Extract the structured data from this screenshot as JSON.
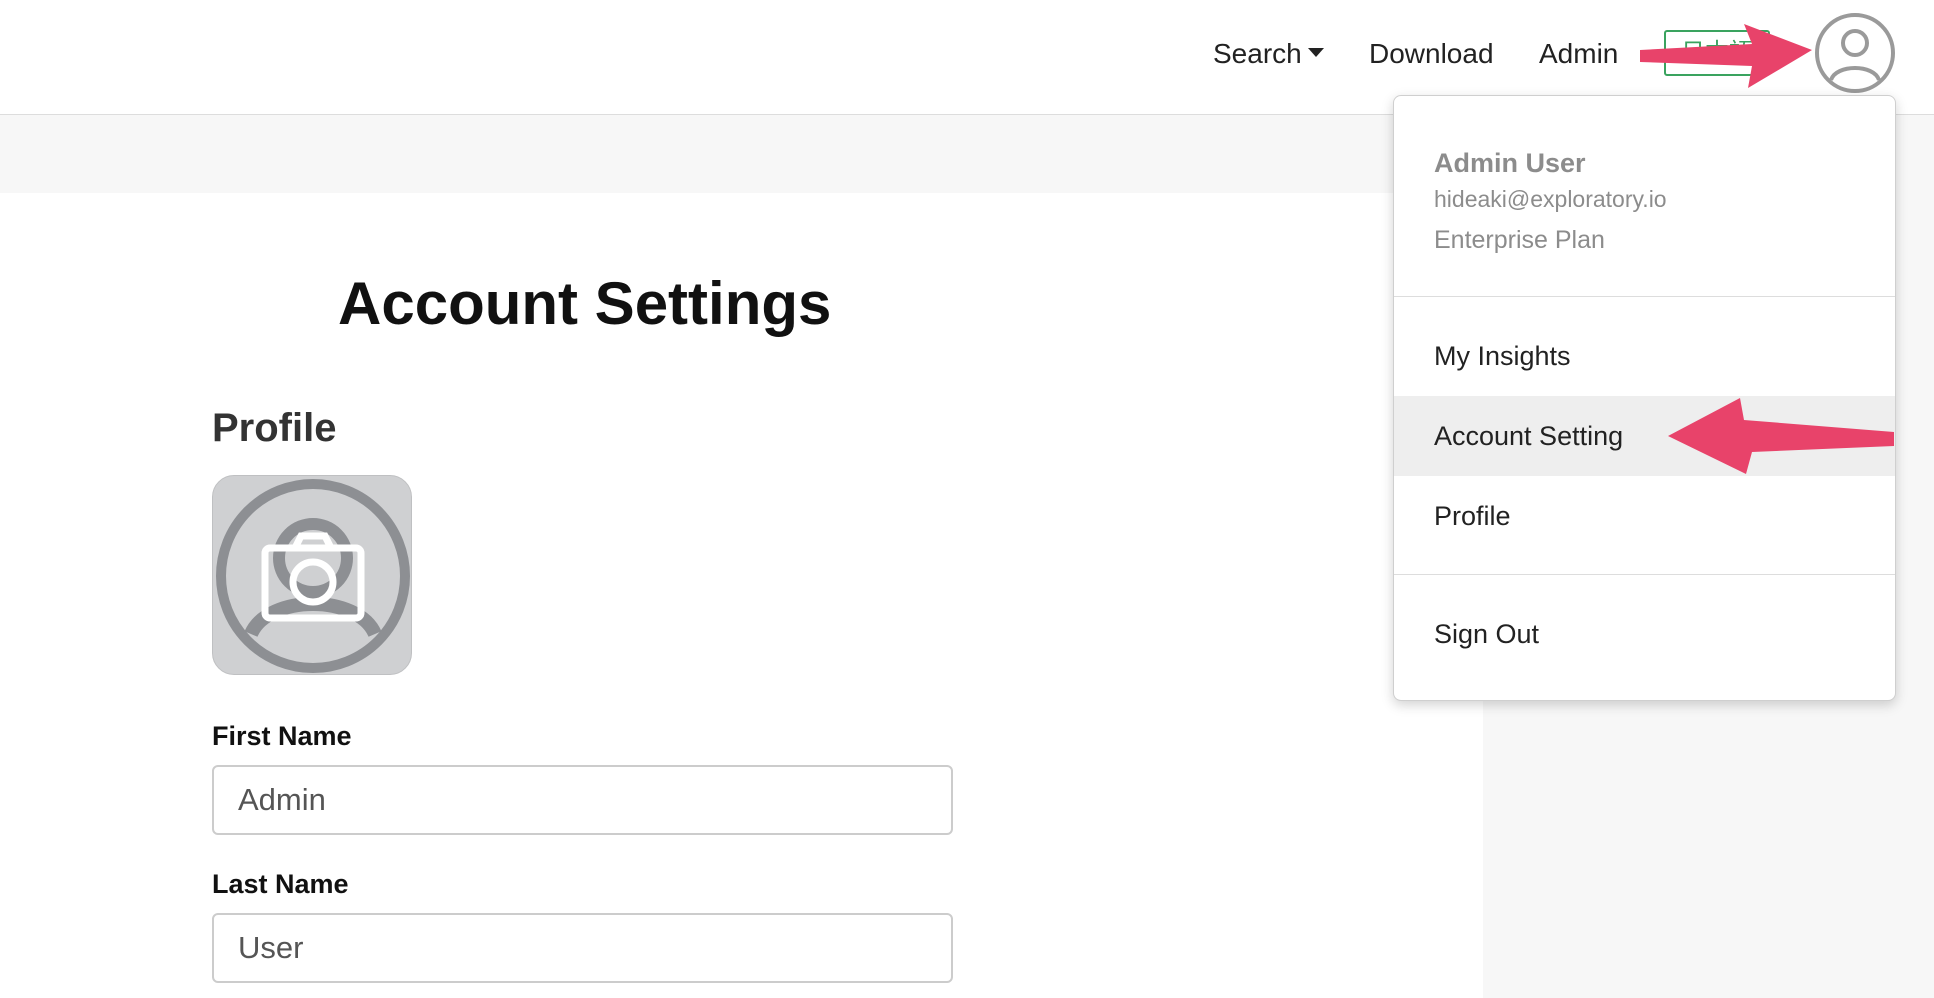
{
  "nav": {
    "search_label": "Search",
    "download_label": "Download",
    "admin_label": "Admin",
    "language_label": "日本語",
    "avatar_icon": "user-circle-icon"
  },
  "page": {
    "title": "Account Settings",
    "section_heading": "Profile",
    "photo_icon": "camera-icon"
  },
  "form": {
    "first_name_label": "First Name",
    "first_name_value": "Admin",
    "last_name_label": "Last Name",
    "last_name_value": "User"
  },
  "dropdown": {
    "user_name": "Admin User",
    "user_email": "hideaki@exploratory.io",
    "user_plan": "Enterprise Plan",
    "items": [
      {
        "label": "My Insights"
      },
      {
        "label": "Account Setting"
      },
      {
        "label": "Profile"
      },
      {
        "label": "Sign Out"
      }
    ],
    "highlighted_item": "Account Setting"
  },
  "colors": {
    "annotation_arrow": "#e8436a",
    "language_border": "#3aa35f",
    "panel_gray": "#f7f7f7"
  }
}
